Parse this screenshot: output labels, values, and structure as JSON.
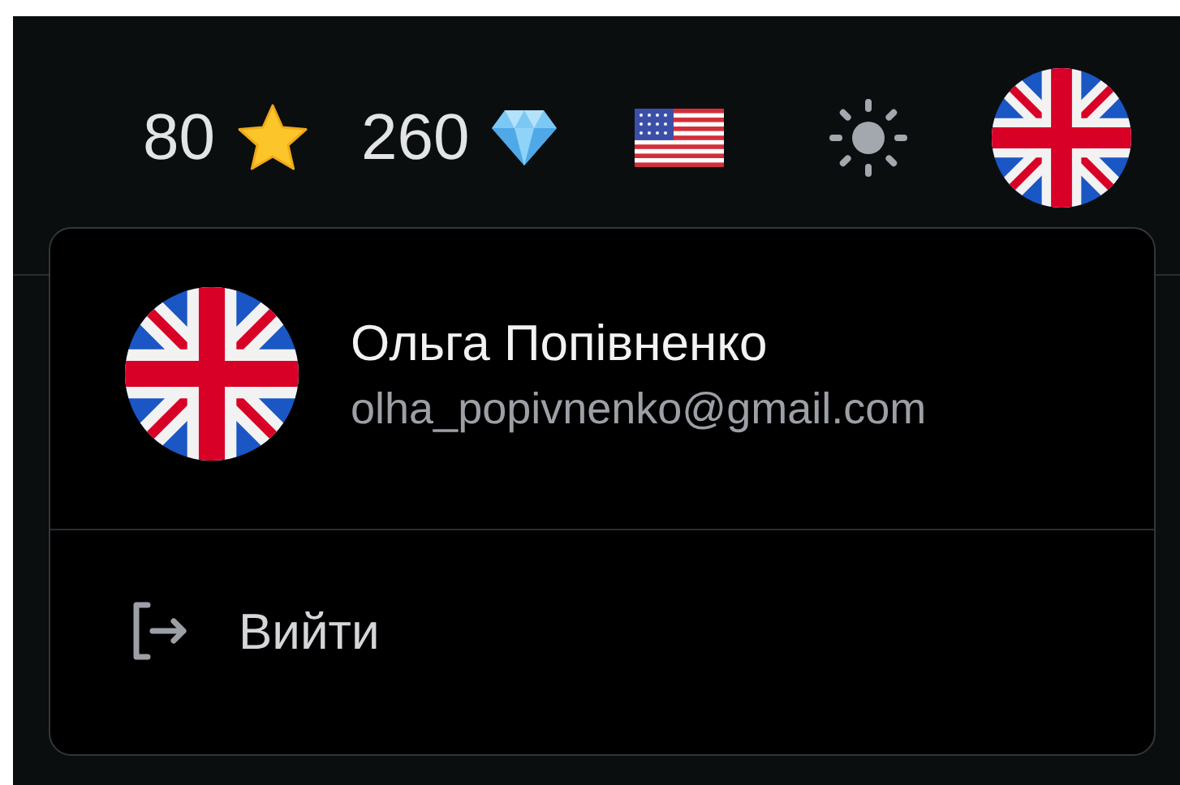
{
  "header": {
    "stats": [
      {
        "kind": "star",
        "value": "80"
      },
      {
        "kind": "gem",
        "value": "260"
      }
    ]
  },
  "user_menu": {
    "name": "Ольга Попівненко",
    "email": "olha_popivnenko@gmail.com",
    "items": [
      {
        "kind": "logout",
        "label": "Вийти"
      }
    ]
  }
}
